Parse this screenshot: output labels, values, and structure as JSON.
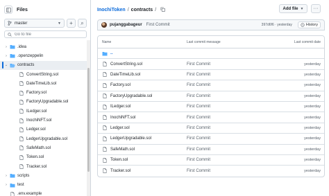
{
  "sidebar": {
    "title": "Files",
    "branch": "master",
    "add_symbol": "+",
    "search_symbol": "⌕",
    "goto_placeholder": "Go to file",
    "items": [
      {
        "label": ".idea",
        "type": "folder",
        "chevron": "›",
        "indent": 0
      },
      {
        "label": ".openzeppelin",
        "type": "folder",
        "chevron": "›",
        "indent": 0
      },
      {
        "label": "contracts",
        "type": "folder-open",
        "chevron": "⌄",
        "indent": 0,
        "active": true
      },
      {
        "label": "ConvertString.sol",
        "type": "file",
        "indent": 1
      },
      {
        "label": "DateTimeLib.sol",
        "type": "file",
        "indent": 1
      },
      {
        "label": "Factory.sol",
        "type": "file",
        "indent": 1
      },
      {
        "label": "FactoryUpgradable.sol",
        "type": "file",
        "indent": 1
      },
      {
        "label": "ILedger.sol",
        "type": "file",
        "indent": 1
      },
      {
        "label": "InochiNFT.sol",
        "type": "file",
        "indent": 1
      },
      {
        "label": "Ledger.sol",
        "type": "file",
        "indent": 1
      },
      {
        "label": "LedgerUpgradable.sol",
        "type": "file",
        "indent": 1
      },
      {
        "label": "SafeMath.sol",
        "type": "file",
        "indent": 1
      },
      {
        "label": "Token.sol",
        "type": "file",
        "indent": 1
      },
      {
        "label": "Tracker.sol",
        "type": "file",
        "indent": 1
      },
      {
        "label": "scripts",
        "type": "folder",
        "chevron": "›",
        "indent": 0
      },
      {
        "label": "test",
        "type": "folder",
        "chevron": "›",
        "indent": 0
      },
      {
        "label": ".env.example",
        "type": "file",
        "indent": 0
      }
    ]
  },
  "header": {
    "repo": "InochiToken",
    "sep": "/",
    "path": "contracts",
    "trail_sep": "/",
    "add_file_label": "Add file",
    "more_symbol": "···"
  },
  "commit": {
    "author": "pujanggabageur",
    "message": "First Commit",
    "hash_time": "397d6f6 · yesterday",
    "history_label": "History"
  },
  "table": {
    "columns": {
      "name": "Name",
      "message": "Last commit message",
      "date": "Last commit date"
    },
    "parent_label": "..",
    "rows": [
      {
        "name": "ConvertString.sol",
        "message": "First Commit",
        "date": "yesterday"
      },
      {
        "name": "DateTimeLib.sol",
        "message": "First Commit",
        "date": "yesterday"
      },
      {
        "name": "Factory.sol",
        "message": "First Commit",
        "date": "yesterday"
      },
      {
        "name": "FactoryUpgradable.sol",
        "message": "First Commit",
        "date": "yesterday"
      },
      {
        "name": "ILedger.sol",
        "message": "First Commit",
        "date": "yesterday"
      },
      {
        "name": "InochiNFT.sol",
        "message": "First Commit",
        "date": "yesterday"
      },
      {
        "name": "Ledger.sol",
        "message": "First Commit",
        "date": "yesterday"
      },
      {
        "name": "LedgerUpgradable.sol",
        "message": "First Commit",
        "date": "yesterday"
      },
      {
        "name": "SafeMath.sol",
        "message": "First Commit",
        "date": "yesterday"
      },
      {
        "name": "Token.sol",
        "message": "First Commit",
        "date": "yesterday"
      },
      {
        "name": "Tracker.sol",
        "message": "First Commit",
        "date": "yesterday"
      }
    ]
  },
  "colors": {
    "accent": "#0969da",
    "folder": "#54aeff",
    "border": "#d0d7de",
    "muted": "#57606a"
  }
}
